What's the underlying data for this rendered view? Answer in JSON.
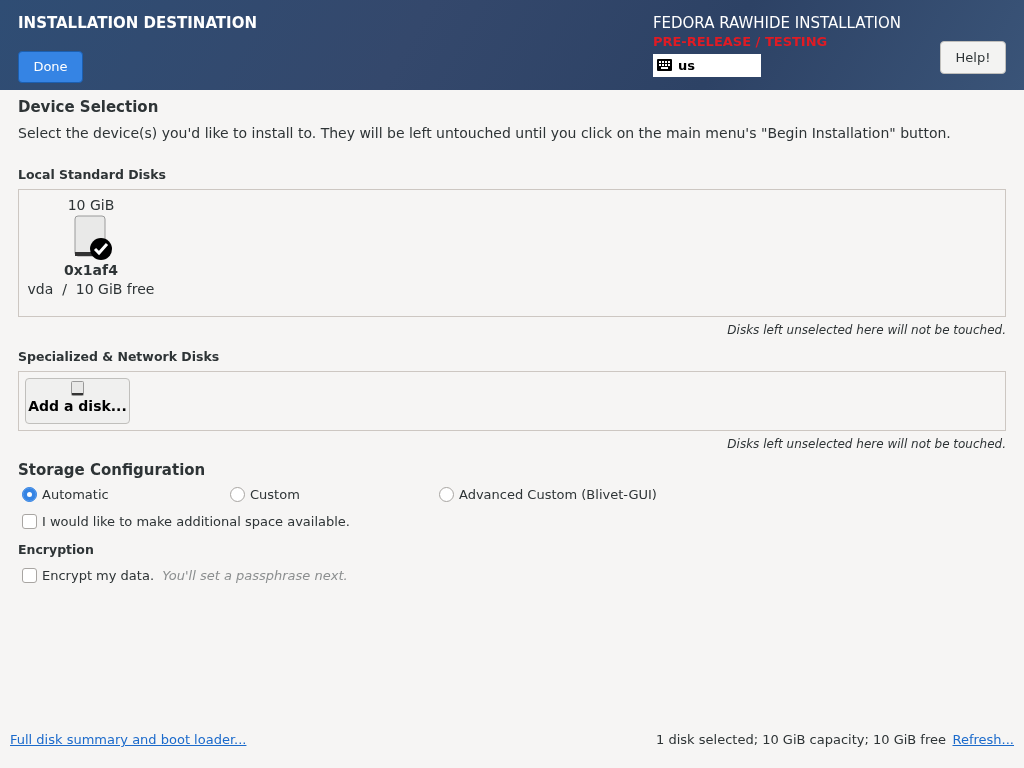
{
  "header": {
    "title": "INSTALLATION DESTINATION",
    "done_button": "Done",
    "product": "FEDORA RAWHIDE INSTALLATION",
    "prerelease": "PRE-RELEASE / TESTING",
    "keyboard_layout": "us",
    "help_button": "Help!"
  },
  "device_selection": {
    "heading": "Device Selection",
    "description": "Select the device(s) you'd like to install to.  They will be left untouched until you click on the main menu's \"Begin Installation\" button."
  },
  "local_disks": {
    "heading": "Local Standard Disks",
    "disks": [
      {
        "size": "10 GiB",
        "name": "0x1af4",
        "detail": "vda  /  10 GiB free",
        "selected": true
      }
    ],
    "note": "Disks left unselected here will not be touched."
  },
  "network_disks": {
    "heading": "Specialized & Network Disks",
    "add_button": "Add a disk...",
    "note": "Disks left unselected here will not be touched."
  },
  "storage_configuration": {
    "heading": "Storage Configuration",
    "options": [
      {
        "label": "Automatic",
        "selected": true
      },
      {
        "label": "Custom",
        "selected": false
      },
      {
        "label": "Advanced Custom (Blivet-GUI)",
        "selected": false
      }
    ],
    "extra_space": {
      "label": "I would like to make additional space available.",
      "checked": false
    }
  },
  "encryption": {
    "heading": "Encryption",
    "checkbox": {
      "label": "Encrypt my data.",
      "checked": false
    },
    "hint": "You'll set a passphrase next."
  },
  "footer": {
    "summary_link": "Full disk summary and boot loader...",
    "status": "1 disk selected; 10 GiB capacity; 10 GiB free",
    "refresh_link": "Refresh..."
  }
}
